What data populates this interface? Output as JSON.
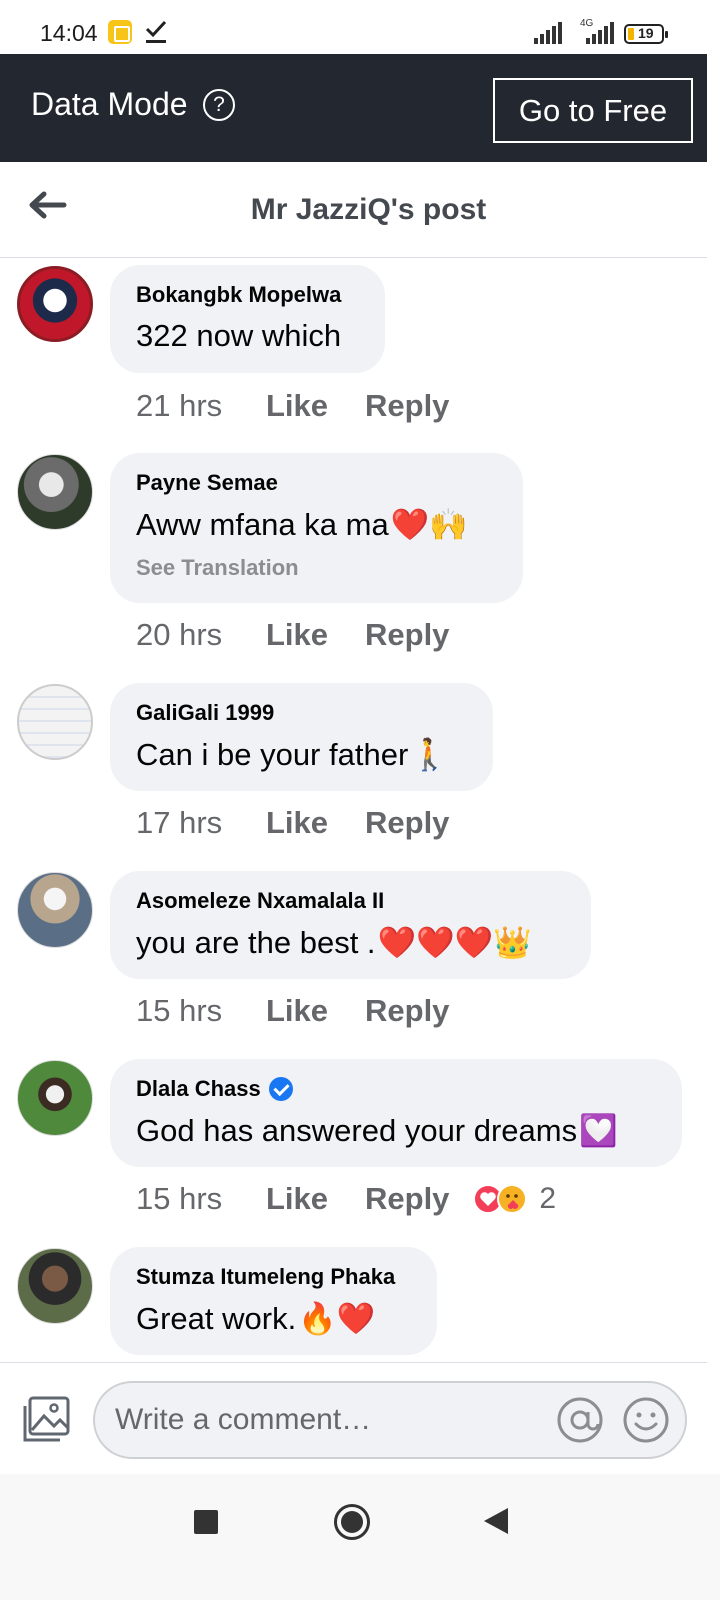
{
  "status_bar": {
    "time": "14:04",
    "network": "4G",
    "battery": "19"
  },
  "banner": {
    "title": "Data Mode",
    "help_glyph": "?",
    "go_free_label": "Go to Free"
  },
  "header": {
    "title": "Mr JazziQ's post"
  },
  "comments": [
    {
      "author": "Bokangbk Mopelwa",
      "text": "322 now which",
      "time": "21 hrs",
      "like": "Like",
      "reply": "Reply"
    },
    {
      "author": "Payne Semae",
      "text": "Aww mfana ka ma",
      "emoji": "❤️🙌",
      "translation": "See Translation",
      "time": "20 hrs",
      "like": "Like",
      "reply": "Reply"
    },
    {
      "author": "GaliGali 1999",
      "text": "Can i be your father ",
      "emoji": "🚶",
      "time": "17 hrs",
      "like": "Like",
      "reply": "Reply"
    },
    {
      "author": "Asomeleze Nxamalala II",
      "text": "you are the best .",
      "emoji": "❤️❤️❤️👑",
      "time": "15 hrs",
      "like": "Like",
      "reply": "Reply"
    },
    {
      "author": "Dlala Chass",
      "verified": true,
      "text": "God has answered your dreams ",
      "emoji": "💟",
      "time": "15 hrs",
      "like": "Like",
      "reply": "Reply",
      "reactions": [
        "love",
        "care"
      ],
      "reaction_count": "2"
    },
    {
      "author": "Stumza Itumeleng Phaka",
      "text": "Great work.",
      "emoji": "🔥❤️"
    }
  ],
  "composer": {
    "placeholder": "Write a comment…"
  },
  "colors": {
    "banner_bg": "#232830",
    "bubble_bg": "#f0f2f5",
    "meta_text": "#65676b",
    "verified": "#1877f2"
  }
}
